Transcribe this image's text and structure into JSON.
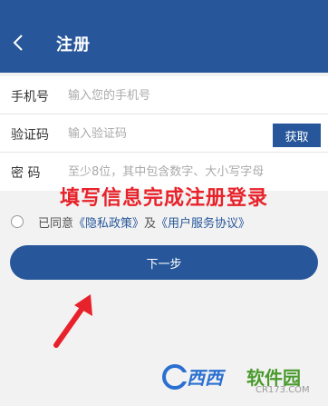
{
  "header": {
    "title": "注册"
  },
  "form": {
    "phone": {
      "label": "手机号",
      "placeholder": "输入您的手机号"
    },
    "code": {
      "label": "验证码",
      "placeholder": "输入验证码",
      "button": "获取"
    },
    "password": {
      "label": "密 码",
      "placeholder": "至少8位，其中包含数字、大小写字母"
    }
  },
  "overlay_caption": "填写信息完成注册登录",
  "agreement": {
    "prefix": "已同意",
    "privacy": "《隐私政策》",
    "middle": "及",
    "terms": "《用户服务协议》"
  },
  "next_button": "下一步",
  "watermark": {
    "brand": "西西",
    "suffix": "软件园",
    "domain": "CR173.COM"
  },
  "colors": {
    "primary": "#27579a",
    "caption": "#e8222a"
  }
}
